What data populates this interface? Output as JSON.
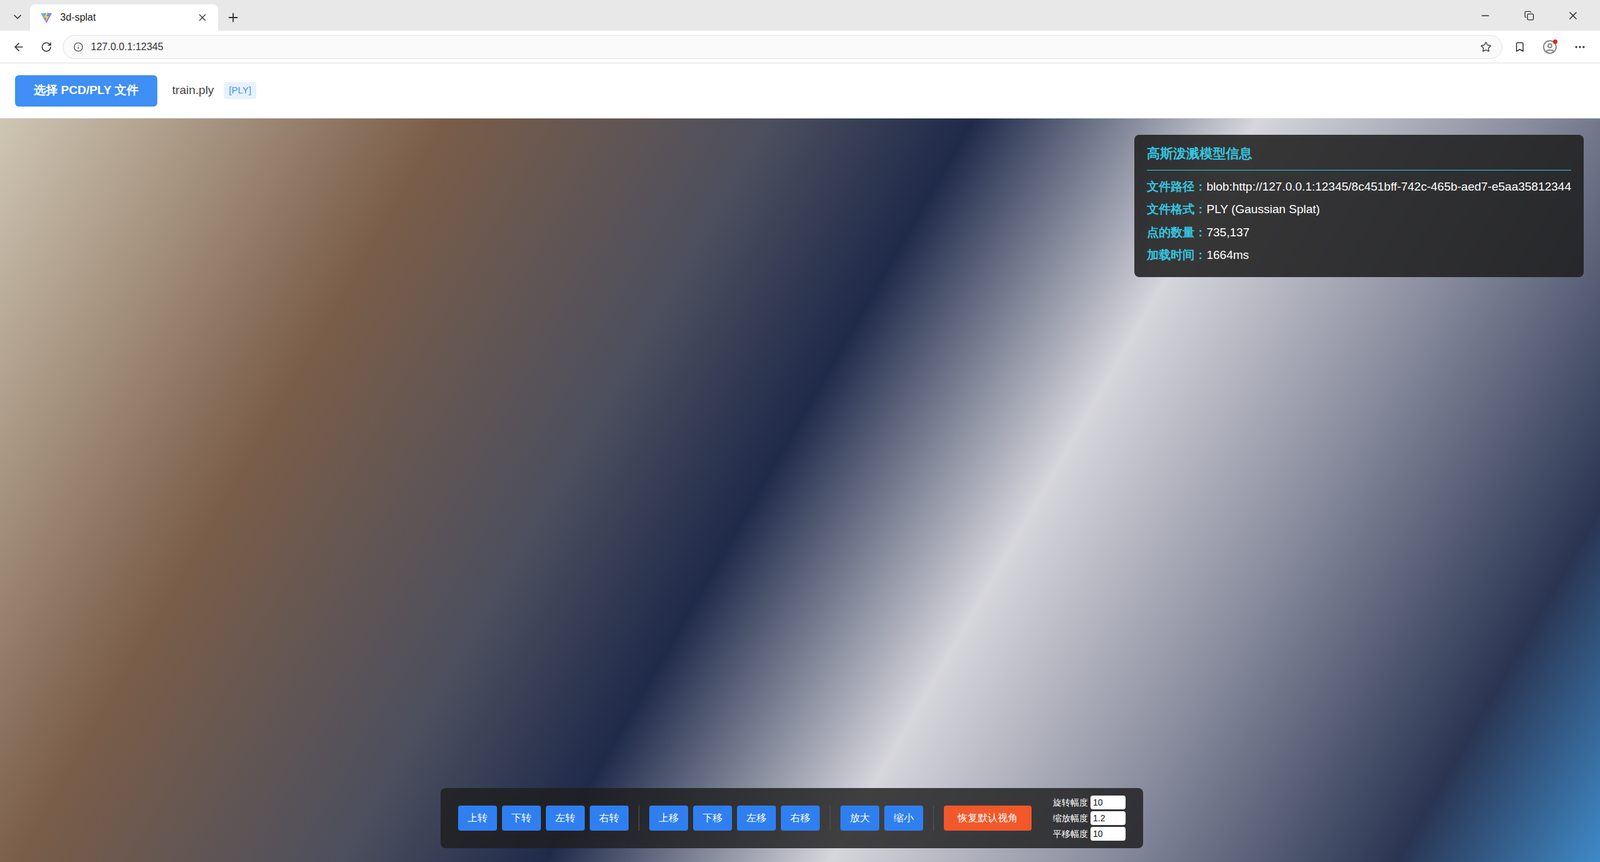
{
  "browser": {
    "tab_title": "3d-splat",
    "address": "127.0.0.1:12345"
  },
  "header": {
    "open_button": "选择 PCD/PLY 文件",
    "file_name": "train.ply",
    "format_badge": "[PLY]"
  },
  "info_panel": {
    "title": "高斯泼溅模型信息",
    "rows": [
      {
        "label": "文件路径：",
        "value": "blob:http://127.0.0.1:12345/8c451bff-742c-465b-aed7-e5aa35812344"
      },
      {
        "label": "文件格式：",
        "value": "PLY (Gaussian Splat)"
      },
      {
        "label": "点的数量：",
        "value": "735,137"
      },
      {
        "label": "加载时间：",
        "value": "1664ms"
      }
    ]
  },
  "toolbar": {
    "groups": [
      {
        "buttons": [
          "上转",
          "下转",
          "左转",
          "右转"
        ]
      },
      {
        "buttons": [
          "上移",
          "下移",
          "左移",
          "右移"
        ]
      },
      {
        "buttons": [
          "放大",
          "缩小"
        ]
      }
    ],
    "reset_button": "恢复默认视角",
    "params": [
      {
        "label": "旋转幅度",
        "value": "10"
      },
      {
        "label": "缩放幅度",
        "value": "1.2"
      },
      {
        "label": "平移幅度",
        "value": "10"
      }
    ]
  }
}
